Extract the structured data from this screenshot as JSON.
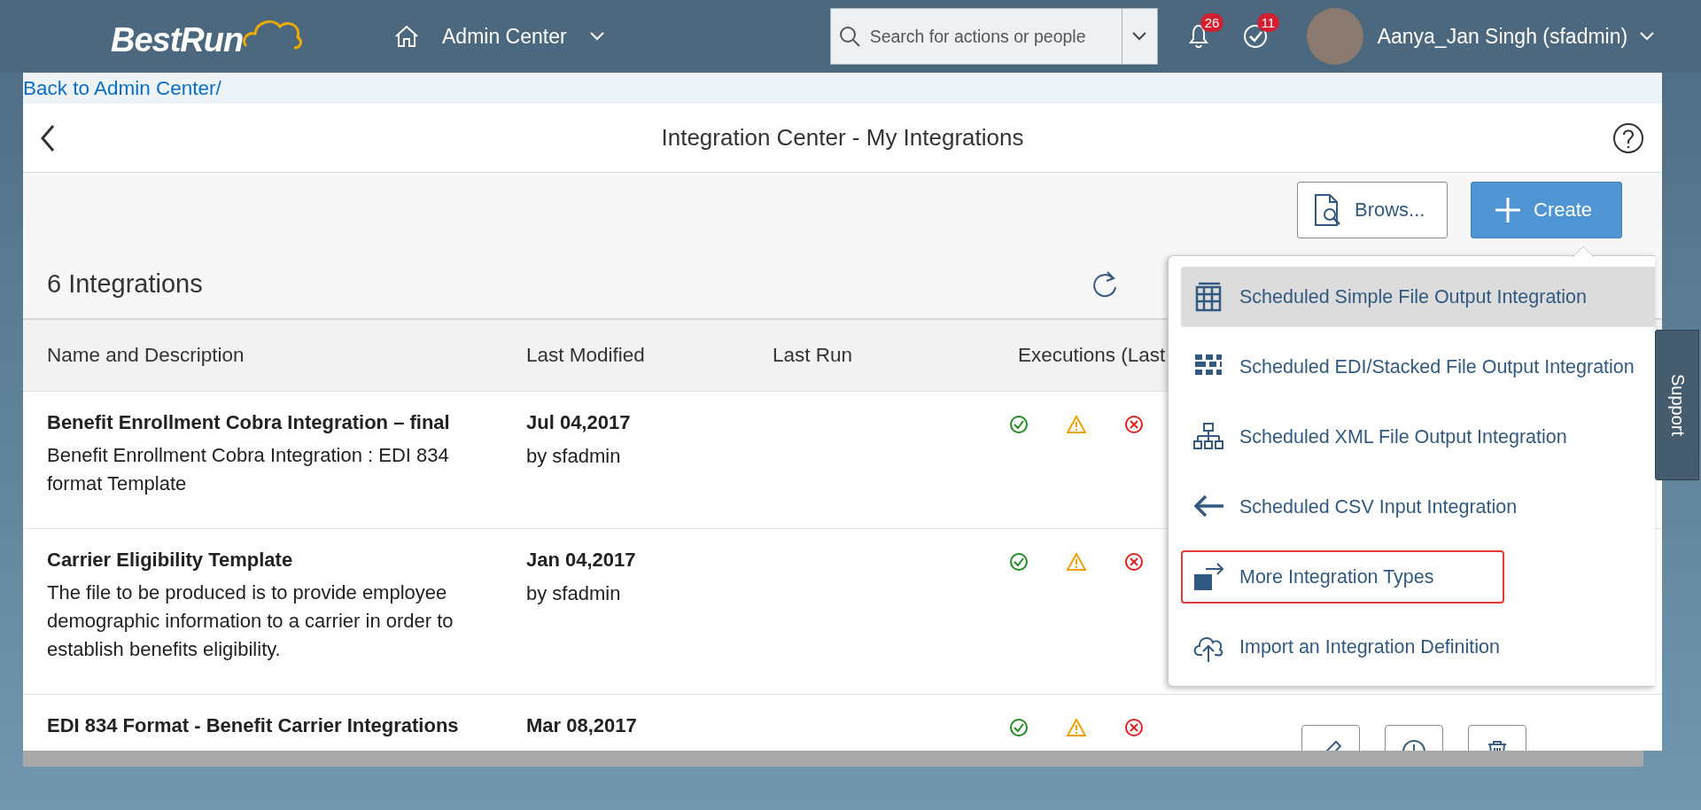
{
  "header": {
    "logo": "BestRun",
    "nav_label": "Admin Center",
    "search": {
      "placeholder": "Search for actions or people"
    },
    "notifications": "26",
    "tasks": "11",
    "user": "Aanya_Jan Singh (sfadmin)"
  },
  "breadcrumb": {
    "link": "Back to Admin Center",
    "separator": "/"
  },
  "page_title": "Integration Center - My Integrations",
  "toolbar": {
    "buttons": [
      {
        "kind": "browse",
        "label": "Brows..."
      },
      {
        "kind": "create",
        "label": "Create"
      }
    ]
  },
  "table": {
    "title": "6 Integrations",
    "columns": [
      "Name and Description",
      "Last Modified",
      "Last Run",
      "Executions (Last"
    ],
    "rows": [
      {
        "name": "Benefit Enrollment Cobra Integration – final",
        "description": "Benefit Enrollment Cobra Integration : EDI 834 format Template",
        "modified": "Jul 04,2017",
        "modified_by": "by sfadmin"
      },
      {
        "name": "Carrier Eligibility Template",
        "description": "The file to be produced is to provide employee demographic information to a carrier in order to establish benefits eligibility.",
        "modified": "Jan 04,2017",
        "modified_by": "by sfadmin"
      },
      {
        "name": "EDI 834 Format - Benefit Carrier Integrations",
        "modified": "Mar 08,2017",
        "actions_shown": true
      }
    ]
  },
  "menu": {
    "items": [
      {
        "kind": "grid",
        "label": "Scheduled Simple File Output Integration",
        "selected": true,
        "outlined": false
      },
      {
        "kind": "stacked",
        "label": "Scheduled EDI/Stacked File Output Integration",
        "selected": false,
        "outlined": false
      },
      {
        "kind": "hierarchy",
        "label": "Scheduled XML File Output Integration",
        "selected": false,
        "outlined": false
      },
      {
        "kind": "arrow",
        "label": "Scheduled CSV Input Integration",
        "selected": false,
        "outlined": false
      },
      {
        "kind": "export",
        "label": "More Integration Types",
        "selected": false,
        "outlined": true
      },
      {
        "kind": "upload",
        "label": "Import an Integration Definition",
        "selected": false,
        "outlined": false
      }
    ]
  },
  "support_tab": "Support"
}
